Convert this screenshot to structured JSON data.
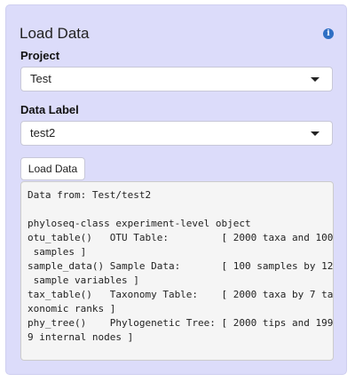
{
  "panel": {
    "title": "Load Data",
    "info_icon": "info-icon"
  },
  "project": {
    "label": "Project",
    "selected": "Test"
  },
  "data_label": {
    "label": "Data Label",
    "selected": "test2"
  },
  "load_button": {
    "label": "Load Data"
  },
  "output": {
    "lines": [
      "Data from: Test/test2",
      "",
      "phyloseq-class experiment-level object",
      "otu_table()   OTU Table:         [ 2000 taxa and 100",
      " samples ]",
      "sample_data() Sample Data:       [ 100 samples by 12",
      " sample variables ]",
      "tax_table()   Taxonomy Table:    [ 2000 taxa by 7 ta",
      "xonomic ranks ]",
      "phy_tree()    Phylogenetic Tree: [ 2000 tips and 199",
      "9 internal nodes ]"
    ]
  },
  "colors": {
    "panel_background": "#dcdcfa",
    "info_icon": "#2f6fc4",
    "output_background": "#f5f5f5"
  }
}
